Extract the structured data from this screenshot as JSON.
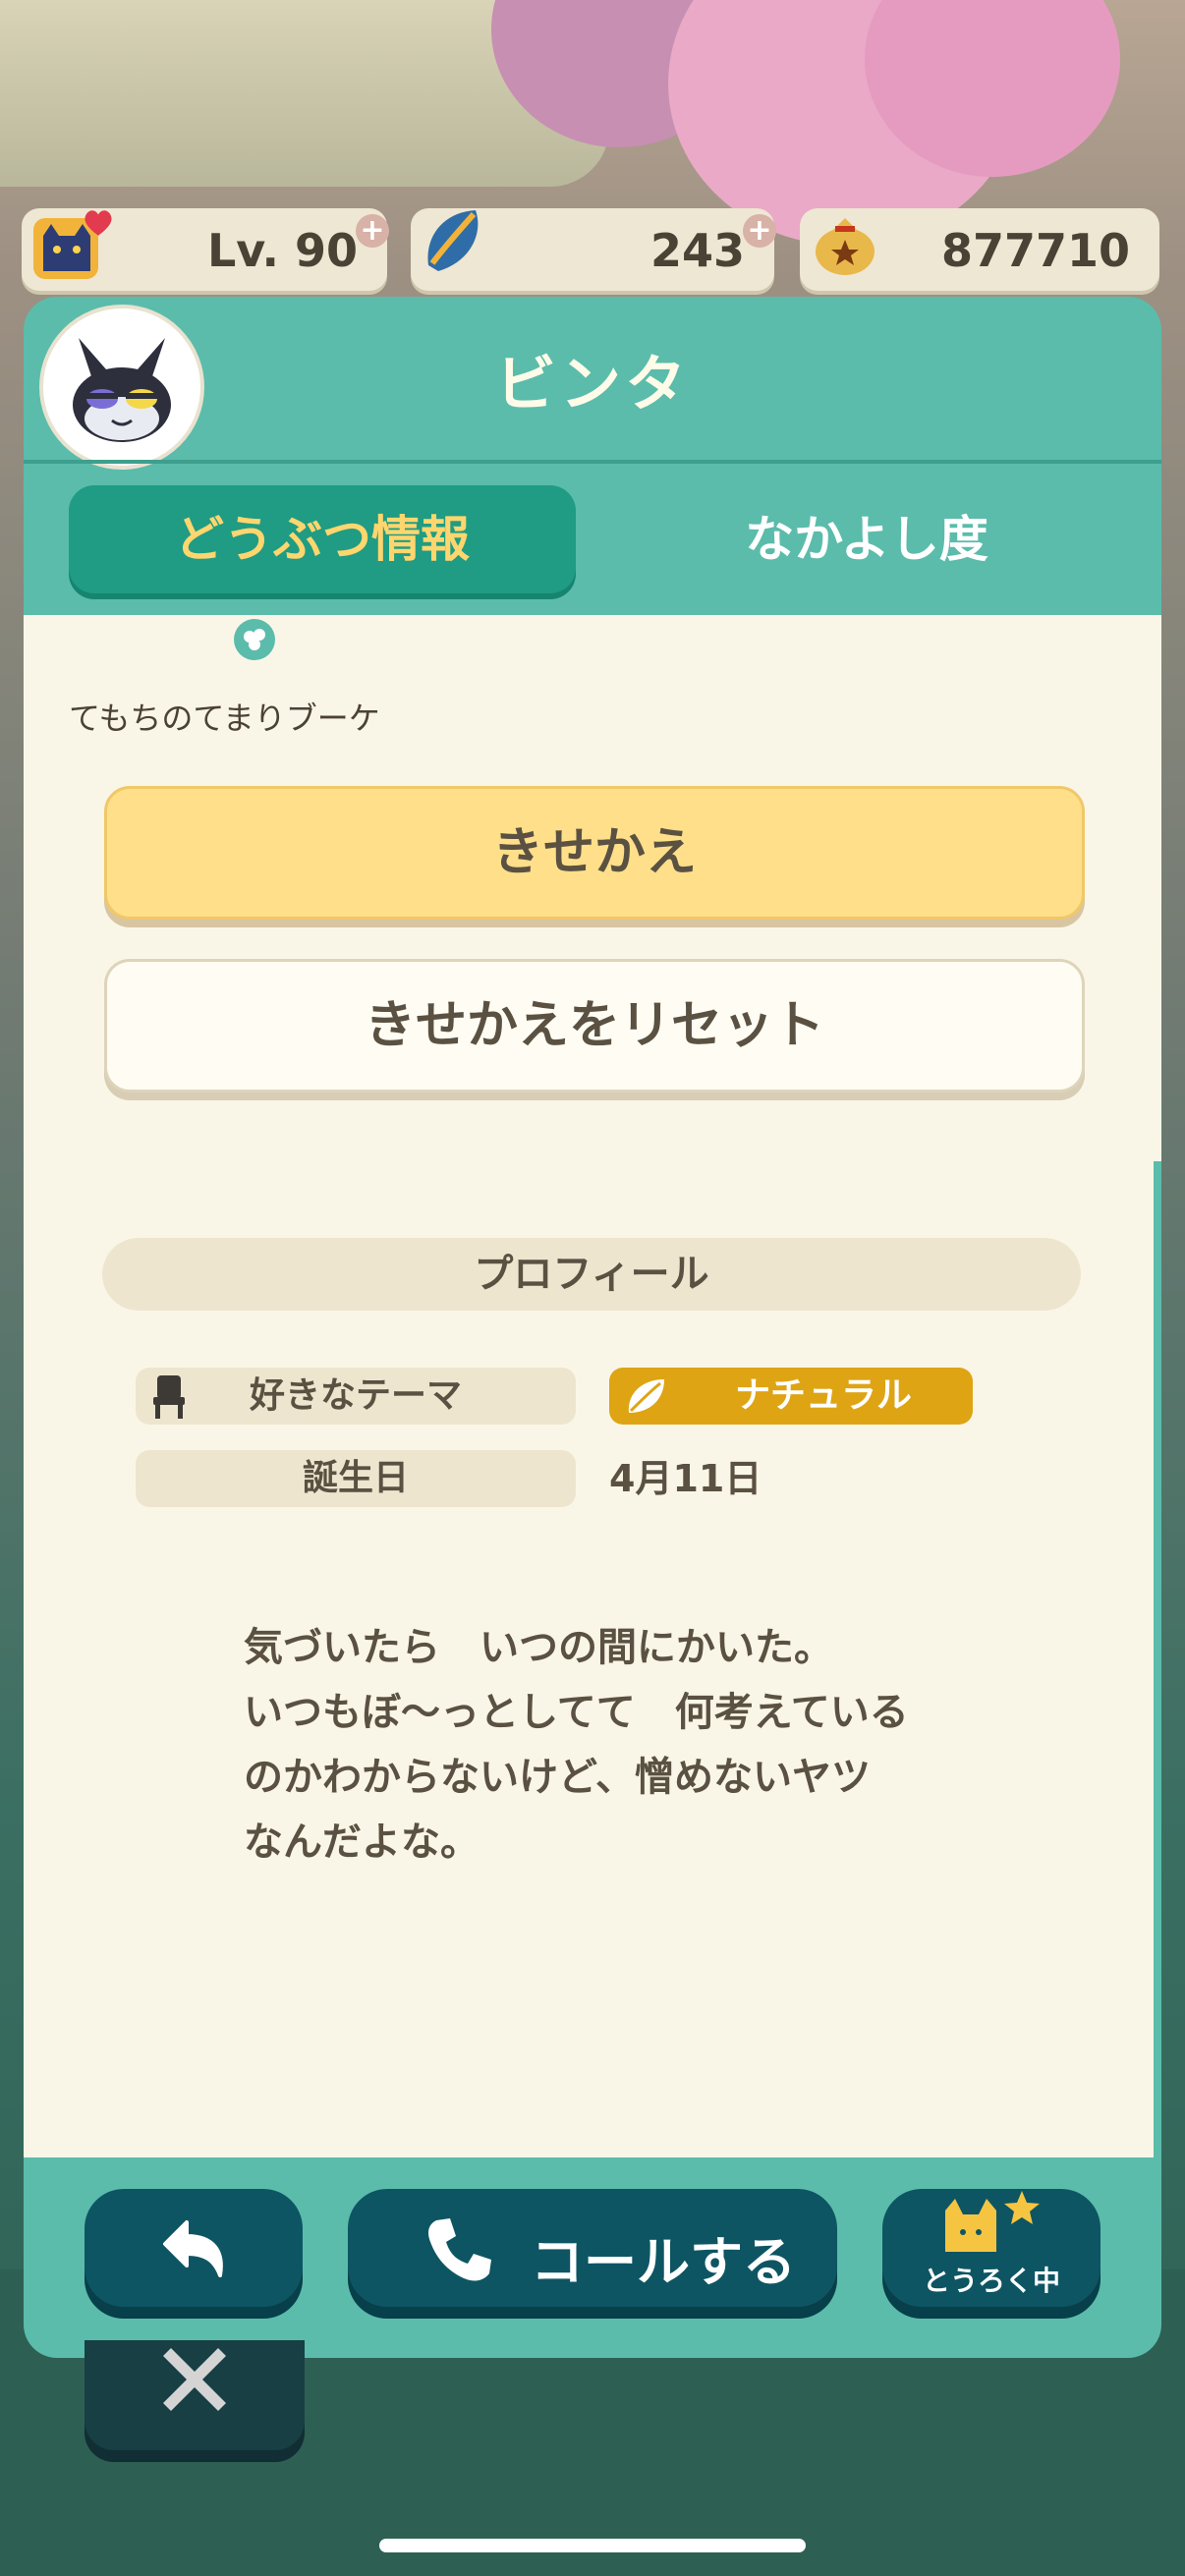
{
  "status_bar": {
    "level": "Lv. 90",
    "leaf_tickets": "243",
    "bells": "877710"
  },
  "villager": {
    "name": "ビンタ"
  },
  "tabs": [
    {
      "label": "どうぶつ情報",
      "active": true
    },
    {
      "label": "なかよし度",
      "active": false
    }
  ],
  "item": {
    "label": "てもちのてまりブーケ"
  },
  "buttons": {
    "dress_up": "きせかえ",
    "reset_dress": "きせかえをリセット"
  },
  "profile": {
    "heading": "プロフィール",
    "favorite_theme_label": "好きなテーマ",
    "favorite_theme_value": "ナチュラル",
    "birthday_label": "誕生日",
    "birthday_value": "4月11日",
    "description": "気づいたら　いつの間にかいた。\nいつもぼ〜っとしてて　何考えている\nのかわからないけど、憎めないヤツ\nなんだよな。"
  },
  "footer": {
    "call_label": "コールする",
    "register_label": "とうろく中"
  },
  "colors": {
    "panel_teal": "#5bbcab",
    "tab_active": "#1f9c83",
    "tab_active_text": "#ffd66e",
    "content_bg": "#faf6e7",
    "button_yellow": "#ffdf8a",
    "theme_badge": "#dea414",
    "footer_button": "#0e5563"
  },
  "icons": [
    "level-cat-icon",
    "heart-icon",
    "leaf-ticket-icon",
    "bell-bag-icon",
    "plus-icon",
    "villager-avatar",
    "bouquet-icon",
    "chair-icon",
    "leaf-icon",
    "back-arrow-icon",
    "phone-icon",
    "cat-star-icon",
    "close-icon"
  ]
}
